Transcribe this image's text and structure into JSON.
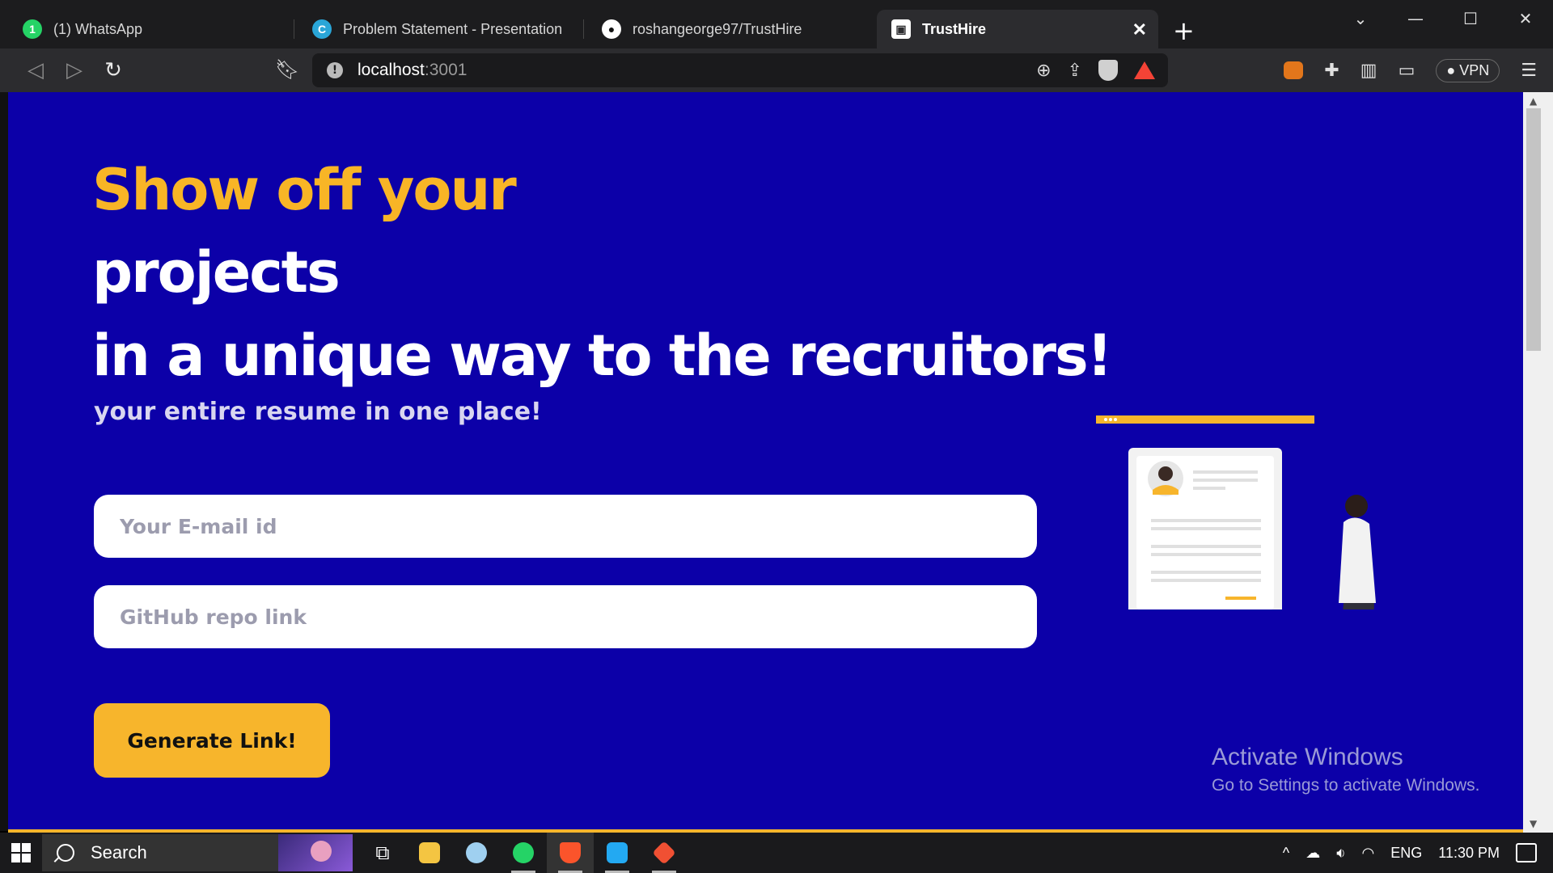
{
  "browser": {
    "tabs": [
      {
        "title": "(1) WhatsApp",
        "icon": "whatsapp-icon",
        "active": false
      },
      {
        "title": "Problem Statement - Presentation",
        "icon": "canva-icon",
        "active": false
      },
      {
        "title": "roshangeorge97/TrustHire",
        "icon": "github-icon",
        "active": false
      },
      {
        "title": "TrustHire",
        "icon": "gift-icon",
        "active": true
      }
    ],
    "new_tab_label": "+",
    "url_host": "localhost",
    "url_port": ":3001",
    "vpn_label": "VPN"
  },
  "page": {
    "headline_line1": "Show off your",
    "headline_line2": "projects",
    "headline_line3": "in a unique way to the recruitors!",
    "subtitle": "your entire resume in one place!",
    "email_placeholder": "Your E-mail id",
    "repo_placeholder": "GitHub repo link",
    "generate_button": "Generate Link!"
  },
  "watermark": {
    "title": "Activate Windows",
    "subtitle": "Go to Settings to activate Windows."
  },
  "taskbar": {
    "search_label": "Search",
    "language": "ENG",
    "time": "11:30 PM"
  },
  "colors": {
    "page_bg": "#0c00a8",
    "accent": "#f7b52c",
    "headline_yellow": "#f8b526"
  }
}
